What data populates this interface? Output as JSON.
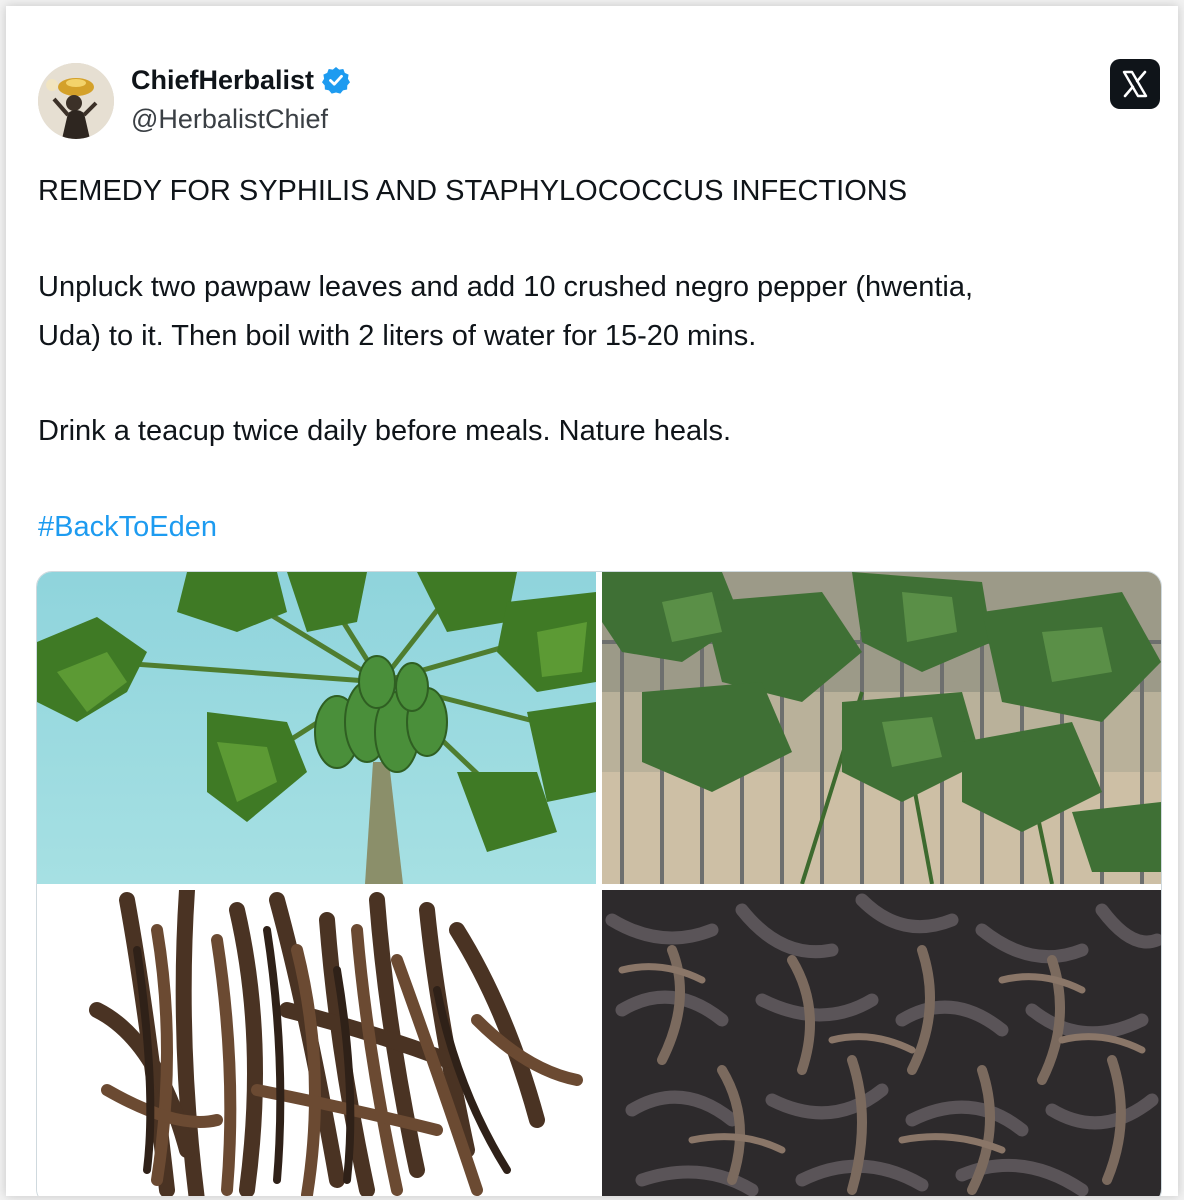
{
  "author": {
    "display_name": "ChiefHerbalist",
    "handle": "@HerbalistChief",
    "verified": true,
    "avatar_icon": "herbalist-avatar"
  },
  "platform_icon": "x-logo-icon",
  "post": {
    "title": "REMEDY FOR SYPHILIS AND STAPHYLOCOCCUS INFECTIONS",
    "line1": "Unpluck two pawpaw leaves and add 10 crushed negro pepper (hwentia,",
    "line2": "Uda) to it. Then boil with 2 liters of water for 15-20 mins.",
    "line3": "Drink a teacup twice daily before meals. Nature heals.",
    "hashtag": "#BackToEden"
  },
  "media": [
    {
      "subject": "papaya-tree-with-fruits-photo"
    },
    {
      "subject": "pawpaw-leaves-photo"
    },
    {
      "subject": "dried-negro-pepper-white-background-photo"
    },
    {
      "subject": "dried-negro-pepper-pile-photo"
    }
  ],
  "colors": {
    "hashtag": "#1d9bf0",
    "verified_badge": "#1d9bf0",
    "text": "#0f1419",
    "x_logo_bg": "#0f1419"
  }
}
